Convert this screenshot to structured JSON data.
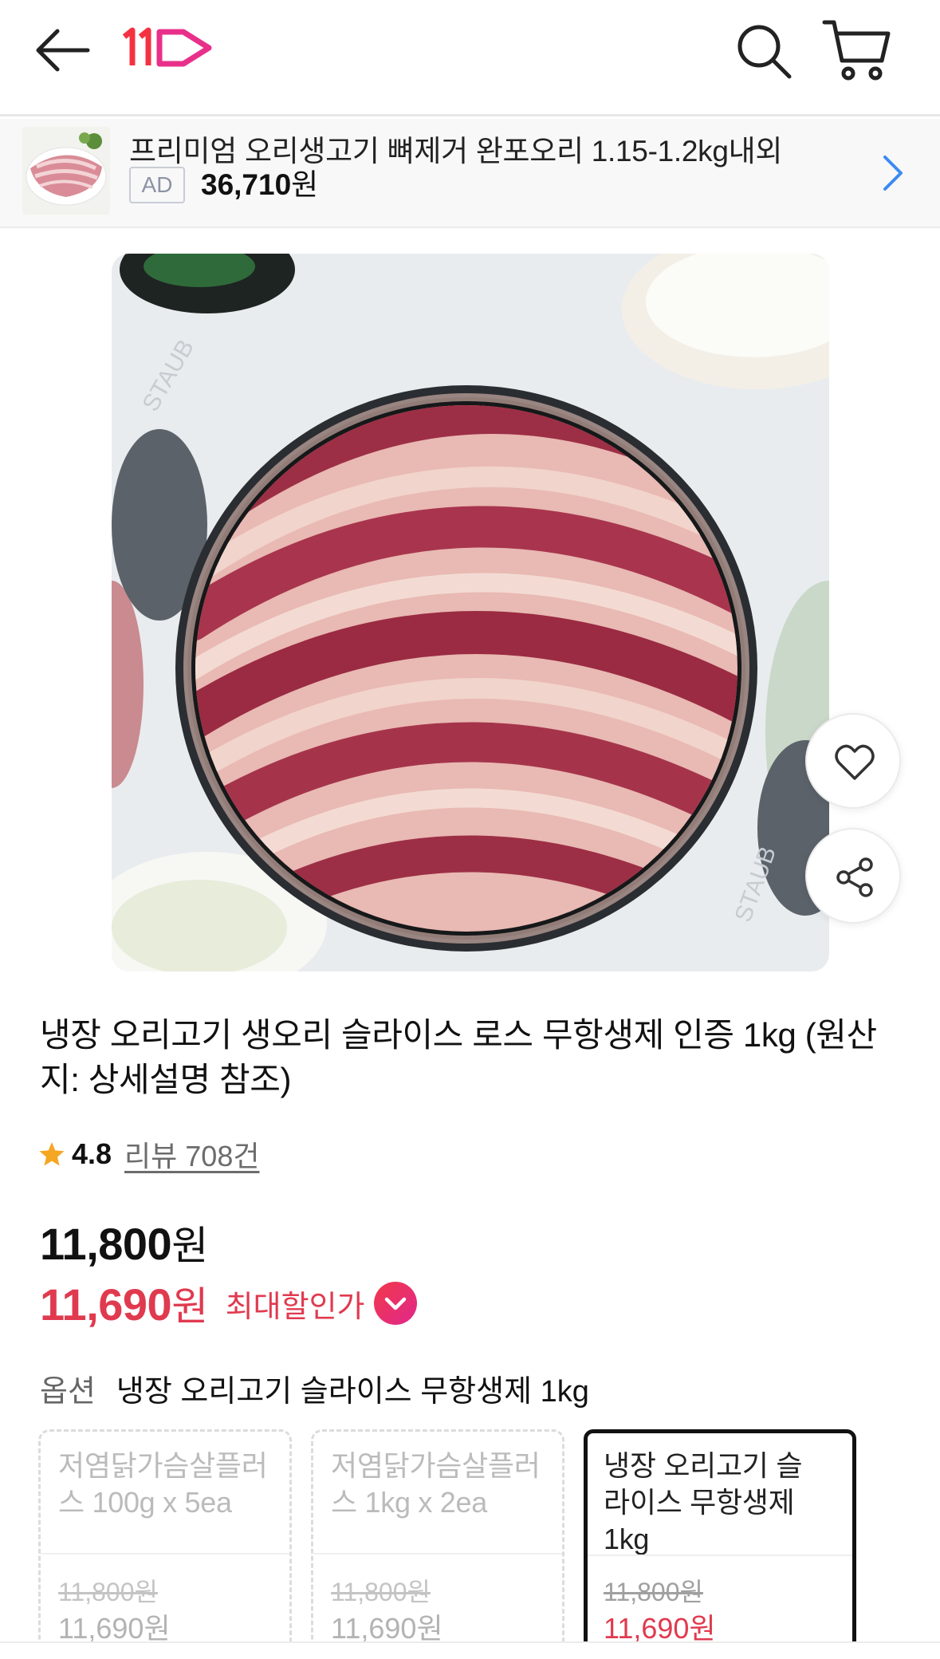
{
  "header": {
    "back_icon": "arrow-left-icon",
    "logo_text": "11",
    "search_icon": "search-icon",
    "cart_icon": "cart-icon",
    "brand_color": "#f43142"
  },
  "ad_banner": {
    "title": "프리미엄 오리생고기 뼈제거 완포오리 1.15-1.2kg내외",
    "badge": "AD",
    "price_number": "36,710",
    "price_unit": "원",
    "chevron_icon": "chevron-right-icon",
    "chevron_color": "#3d8bf2"
  },
  "product": {
    "image_icon": "product-photo",
    "title": "냉장 오리고기 생오리 슬라이스 로스 무항생제 인증 1kg (원산지: 상세설명 참조)",
    "like_icon": "heart-icon",
    "share_icon": "share-icon"
  },
  "rating": {
    "star_icon": "star-icon",
    "score": "4.8",
    "reviews_label": "리뷰 708건"
  },
  "price": {
    "original_number": "11,800",
    "original_unit": "원",
    "sale_number": "11,690",
    "sale_unit": "원",
    "max_discount_label": "최대할인가",
    "toggle_icon": "chevron-down-icon",
    "sale_color": "#e03a4f"
  },
  "option": {
    "label": "옵션",
    "selected_value": "냉장 오리고기 슬라이스 무항생제 1kg",
    "cards": [
      {
        "name": "저염닭가슴살플러스 100g x 5ea",
        "original_price": "11,800원",
        "sale_price": "11,690원",
        "selected": false
      },
      {
        "name": "저염닭가슴살플러스 1kg x 2ea",
        "original_price": "11,800원",
        "sale_price": "11,690원",
        "selected": false
      },
      {
        "name": "냉장 오리고기 슬라이스 무항생제 1kg",
        "original_price": "11,800원",
        "sale_price": "11,690원",
        "selected": true
      }
    ]
  }
}
